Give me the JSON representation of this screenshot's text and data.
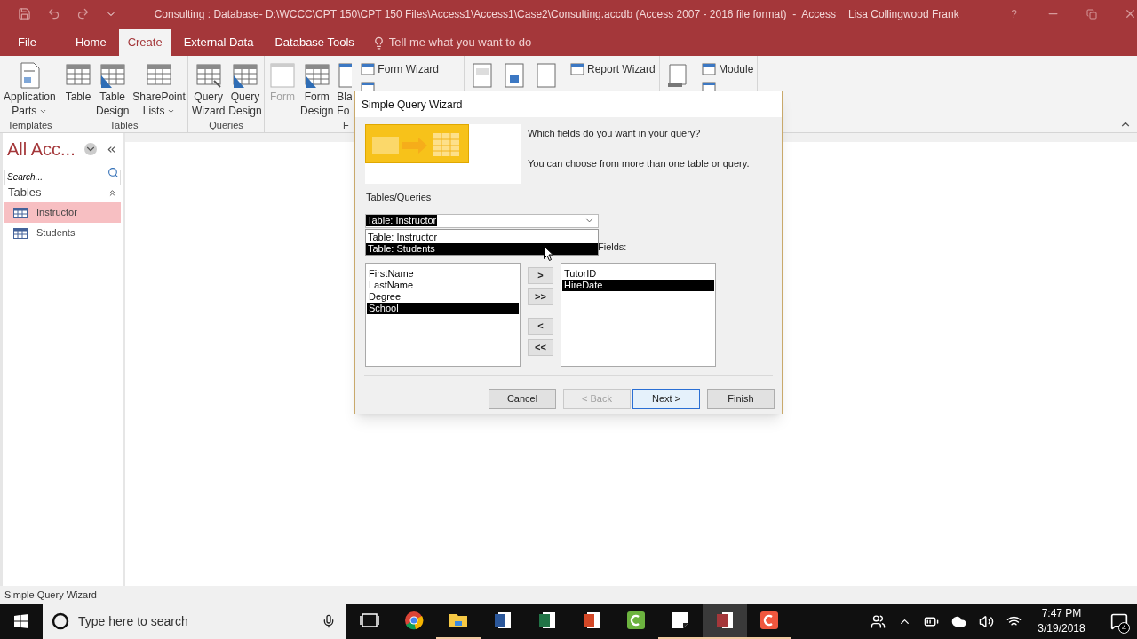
{
  "title_bar": {
    "title": "Consulting : Database- D:\\WCCC\\CPT 150\\CPT 150 Files\\Access1\\Access1\\Case2\\Consulting.accdb (Access 2007 - 2016 file format)  -  Access",
    "user": "Lisa Collingwood Frank",
    "help": "?"
  },
  "ribbon_tabs": [
    {
      "label": "File",
      "selected": false
    },
    {
      "label": "Home",
      "selected": false
    },
    {
      "label": "Create",
      "selected": true
    },
    {
      "label": "External Data",
      "selected": false
    },
    {
      "label": "Database Tools",
      "selected": false
    }
  ],
  "tell_me": "Tell me what you want to do",
  "ribbon_groups": [
    {
      "label": "Templates",
      "large": [
        {
          "kind": "parts",
          "lines": [
            "Application",
            "Parts"
          ],
          "dropdown": true,
          "disabled": false
        }
      ]
    },
    {
      "label": "Tables",
      "large": [
        {
          "kind": "table",
          "lines": [
            "Table"
          ],
          "disabled": false
        },
        {
          "kind": "table-design",
          "lines": [
            "Table",
            "Design"
          ],
          "disabled": false
        },
        {
          "kind": "list",
          "lines": [
            "SharePoint",
            "Lists"
          ],
          "dropdown": true,
          "disabled": false
        }
      ]
    },
    {
      "label": "Queries",
      "large": [
        {
          "kind": "query-wizard",
          "lines": [
            "Query",
            "Wizard"
          ],
          "disabled": false
        },
        {
          "kind": "query-design",
          "lines": [
            "Query",
            "Design"
          ],
          "disabled": false
        }
      ]
    },
    {
      "label": "F",
      "large": [
        {
          "kind": "form",
          "lines": [
            "Form"
          ],
          "disabled": true
        },
        {
          "kind": "form-design",
          "lines": [
            "Form",
            "Design"
          ],
          "disabled": false
        },
        {
          "kind": "blank-form",
          "lines": [
            "Bla",
            "Fo"
          ],
          "disabled": false
        }
      ],
      "small": [
        {
          "kind": "command",
          "label": "Form Wizard"
        },
        {
          "kind": "covered"
        }
      ]
    },
    {
      "large": [
        {
          "kind": "report",
          "disabled": false
        },
        {
          "kind": "report-design",
          "disabled": false
        },
        {
          "kind": "blank-report",
          "disabled": false
        }
      ],
      "small": [
        {
          "kind": "command",
          "label": "Report Wizard"
        }
      ]
    },
    {
      "large": [
        {
          "kind": "macro",
          "disabled": false
        }
      ],
      "small": [
        {
          "kind": "command",
          "label": "Module"
        },
        {
          "kind": "covered"
        }
      ]
    }
  ],
  "nav_pane": {
    "title": "All Acc...",
    "search_placeholder": "Search...",
    "group": "Tables",
    "items": [
      {
        "label": "Instructor",
        "selected": true
      },
      {
        "label": "Students",
        "selected": false
      }
    ]
  },
  "dialog": {
    "title": "Simple Query Wizard",
    "prompt": "Which fields do you want in your query?",
    "hint": "You can choose from more than one table or query.",
    "tables_label": "Tables/Queries",
    "combo_value": "Table: Instructor",
    "combo_options": [
      {
        "label": "Table: Instructor",
        "selected": false
      },
      {
        "label": "Table: Students",
        "selected": true
      }
    ],
    "selected_label": "Fields:",
    "available_fields": [
      {
        "label": "FirstName",
        "selected": false
      },
      {
        "label": "LastName",
        "selected": false
      },
      {
        "label": "Degree",
        "selected": false
      },
      {
        "label": "School",
        "selected": true
      }
    ],
    "move_buttons": [
      ">",
      ">>",
      "<",
      "<<"
    ],
    "selected_fields": [
      {
        "label": "TutorID",
        "selected": false
      },
      {
        "label": "HireDate",
        "selected": true
      }
    ],
    "buttons": [
      {
        "label": "Cancel",
        "disabled": false,
        "default": false
      },
      {
        "label": "< Back",
        "disabled": true,
        "default": false
      },
      {
        "label": "Next >",
        "disabled": false,
        "default": true
      },
      {
        "label": "Finish",
        "disabled": false,
        "default": false
      }
    ]
  },
  "status_bar": "Simple Query Wizard",
  "taskbar": {
    "search_placeholder": "Type here to search",
    "apps": [
      {
        "kind": "task-view",
        "running": false,
        "active": false
      },
      {
        "kind": "chrome",
        "running": false,
        "active": false
      },
      {
        "kind": "folder",
        "running": true,
        "active": false
      },
      {
        "kind": "word",
        "running": false,
        "active": false
      },
      {
        "kind": "excel",
        "running": false,
        "active": false
      },
      {
        "kind": "powerpoint",
        "running": false,
        "active": false
      },
      {
        "kind": "editor",
        "running": false,
        "active": false
      },
      {
        "kind": "notes",
        "running": true,
        "active": false
      },
      {
        "kind": "access",
        "running": true,
        "active": true
      },
      {
        "kind": "recorder",
        "running": true,
        "active": false
      }
    ],
    "time": "7:47 PM",
    "date": "3/19/2018",
    "notifications": "4"
  }
}
